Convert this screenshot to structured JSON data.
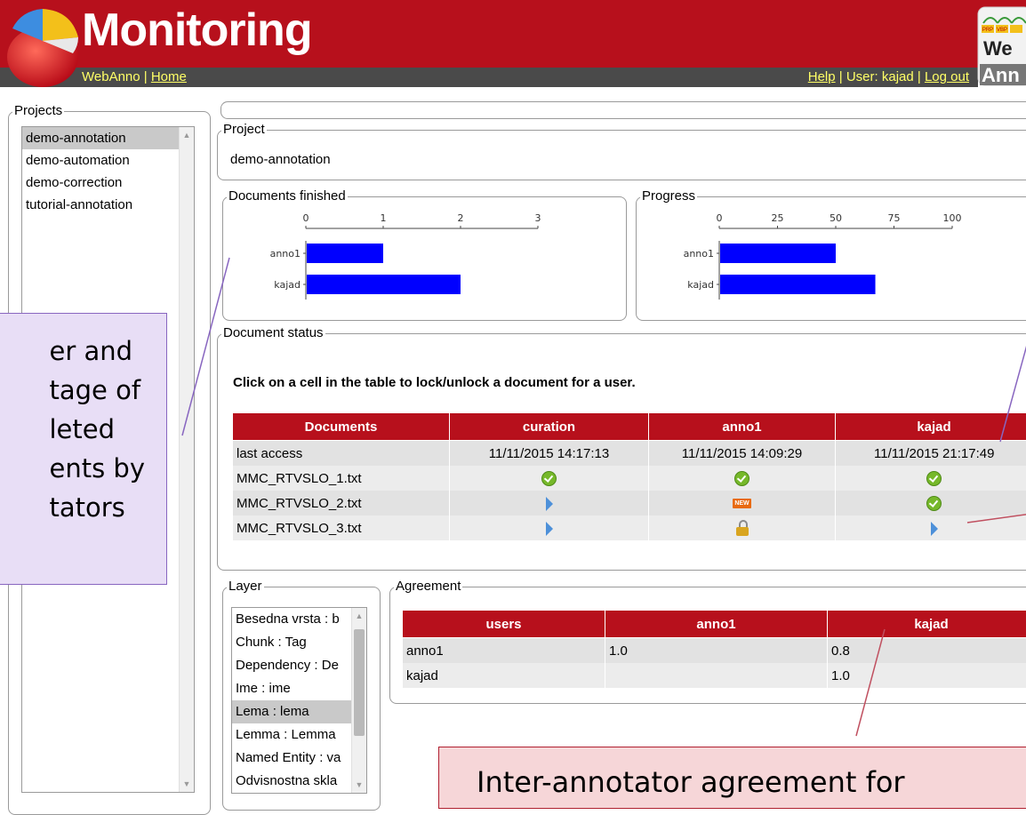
{
  "header": {
    "title": "Monitoring",
    "nav_left": {
      "app": "WebAnno",
      "sep": " | ",
      "home": "Home"
    },
    "nav_right": {
      "help": "Help",
      "sep": " | ",
      "user": "User: kajad",
      "logout": "Log out"
    },
    "brand_colors": {
      "red": "#b7101c",
      "grey": "#4a4a4a",
      "link": "#ffff66"
    }
  },
  "projects": {
    "legend": "Projects",
    "items": [
      "demo-annotation",
      "demo-automation",
      "demo-correction",
      "tutorial-annotation"
    ],
    "selected": "demo-annotation"
  },
  "project": {
    "legend": "Project",
    "name": "demo-annotation"
  },
  "documents_finished": {
    "legend": "Documents finished",
    "chart_data": {
      "type": "bar",
      "orientation": "horizontal",
      "categories": [
        "anno1",
        "kajad"
      ],
      "values": [
        1,
        2
      ],
      "xlim": [
        0,
        3
      ],
      "ticks": [
        0,
        1,
        2,
        3
      ],
      "color": "#0000ff"
    }
  },
  "progress": {
    "legend": "Progress",
    "chart_data": {
      "type": "bar",
      "orientation": "horizontal",
      "categories": [
        "anno1",
        "kajad"
      ],
      "values": [
        50,
        67
      ],
      "xlim": [
        0,
        100
      ],
      "ticks": [
        0,
        25,
        50,
        75,
        100
      ],
      "color": "#0000ff"
    }
  },
  "document_status": {
    "legend": "Document status",
    "instruction": "Click on a cell in the table to lock/unlock a document for a user.",
    "columns": [
      "Documents",
      "curation",
      "anno1",
      "kajad"
    ],
    "last_access": {
      "label": "last access",
      "values": [
        "11/11/2015 14:17:13",
        "11/11/2015 14:09:29",
        "11/11/2015 21:17:49"
      ]
    },
    "rows": [
      {
        "doc": "MMC_RTVSLO_1.txt",
        "states": [
          "finished",
          "finished",
          "finished"
        ]
      },
      {
        "doc": "MMC_RTVSLO_2.txt",
        "states": [
          "in-progress",
          "new",
          "finished"
        ]
      },
      {
        "doc": "MMC_RTVSLO_3.txt",
        "states": [
          "in-progress",
          "locked",
          "in-progress"
        ]
      }
    ],
    "new_badge": "NEW"
  },
  "layer": {
    "legend": "Layer",
    "items": [
      "Besedna vrsta : b",
      "Chunk : Tag",
      "Dependency : De",
      "Ime : ime",
      "Lema : lema",
      "Lemma : Lemma",
      "Named Entity : va",
      "Odvisnostna skla"
    ],
    "selected": "Lema : lema"
  },
  "agreement": {
    "legend": "Agreement",
    "columns": [
      "users",
      "anno1",
      "kajad"
    ],
    "rows": [
      {
        "user": "anno1",
        "anno1": "1.0",
        "kajad": "0.8"
      },
      {
        "user": "kajad",
        "anno1": "",
        "kajad": "1.0"
      }
    ]
  },
  "callouts": {
    "left_lines": [
      "er and",
      "tage of",
      "leted",
      "ents by",
      "tators"
    ],
    "bottom": "Inter-annotator agreement for"
  }
}
